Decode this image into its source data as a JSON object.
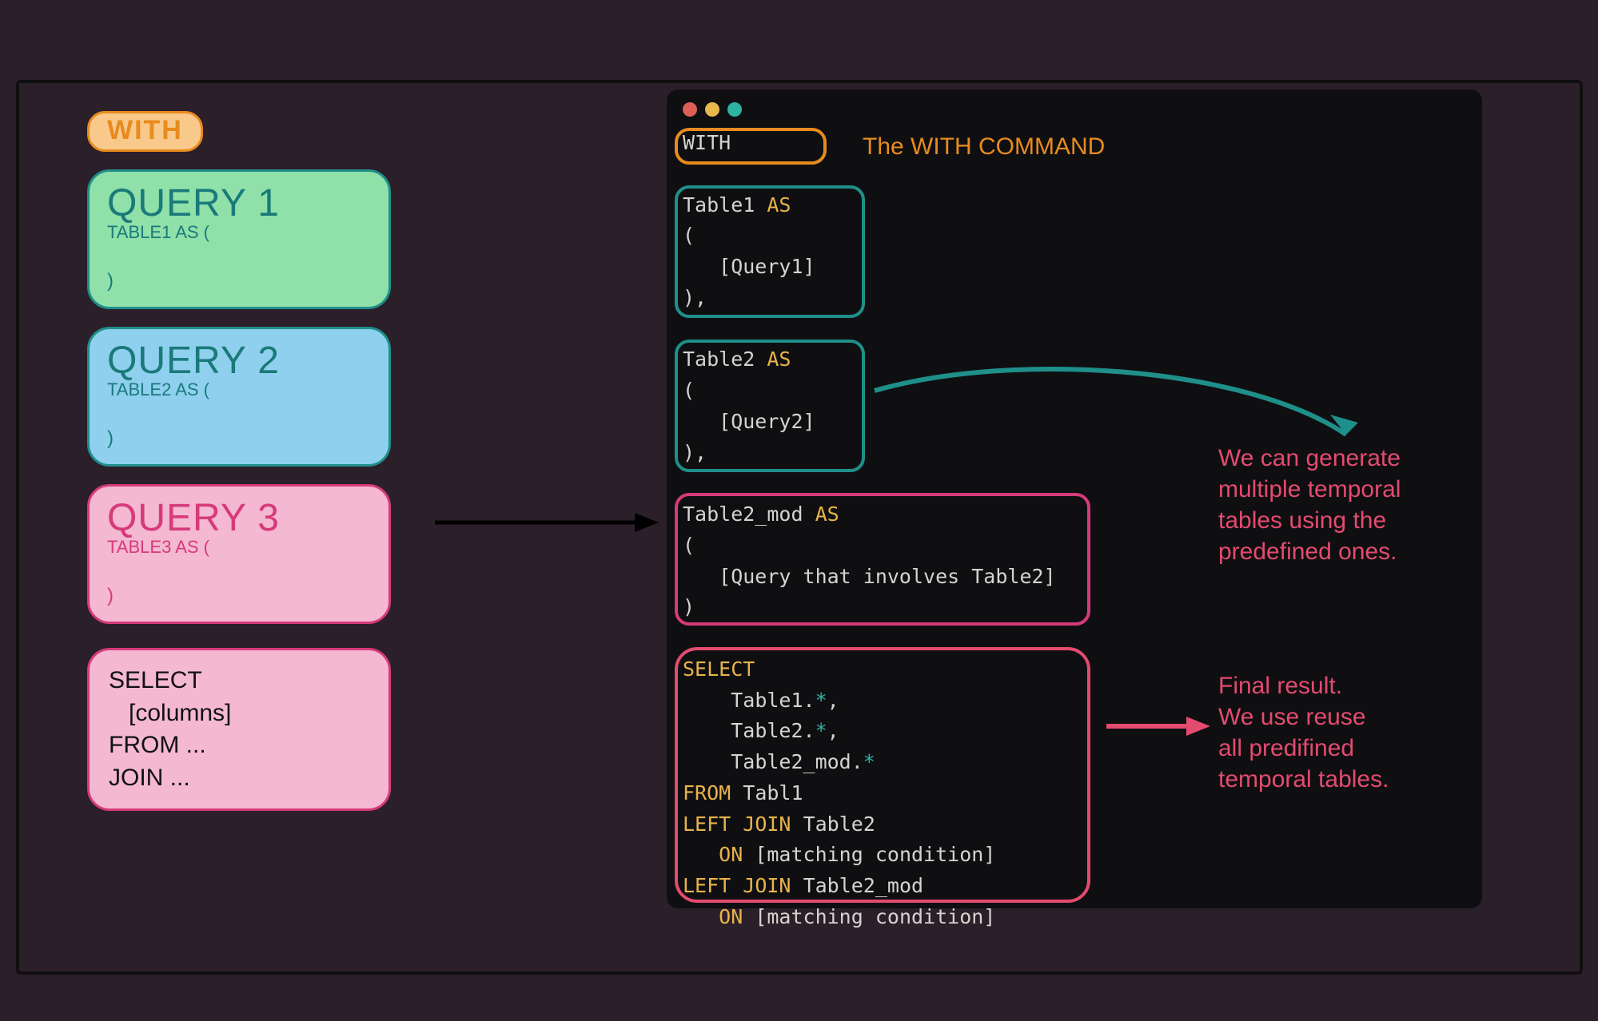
{
  "left": {
    "with_label": "WITH",
    "q1": {
      "title": "QUERY 1",
      "sub": "TABLE1 AS (",
      "close": ")"
    },
    "q2": {
      "title": "QUERY 2",
      "sub": "TABLE2 AS (",
      "close": ")"
    },
    "q3": {
      "title": "QUERY 3",
      "sub": "TABLE3 AS (",
      "close": ")"
    },
    "select_lines": [
      "SELECT",
      "   [columns]",
      "FROM ...",
      "JOIN ..."
    ]
  },
  "code": {
    "with": "WITH",
    "t1_name": "Table1",
    "t2_name": "Table2",
    "t2mod_name": "Table2_mod",
    "as": "AS",
    "open": "(",
    "close_cont": "),",
    "close_last": ")",
    "q1": "[Query1]",
    "q2": "[Query2]",
    "q2mod": "[Query that involves Table2]",
    "select": "SELECT",
    "col1": "Table1.",
    "col2": "Table2.",
    "col3": "Table2_mod.",
    "star": "*",
    "comma": ",",
    "from": "FROM",
    "from_tbl": "Tabl1",
    "left": "LEFT",
    "join": "JOIN",
    "join1_tbl": "Table2",
    "join2_tbl": "Table2_mod",
    "on": "ON",
    "cond": "[matching condition]"
  },
  "annotations": {
    "with_cmd": "The WITH COMMAND",
    "gen_tables": "We can generate\nmultiple temporal\ntables using the\npredefined ones.",
    "final": "Final result.\nWe use reuse\nall predifined\ntemporal tables."
  }
}
